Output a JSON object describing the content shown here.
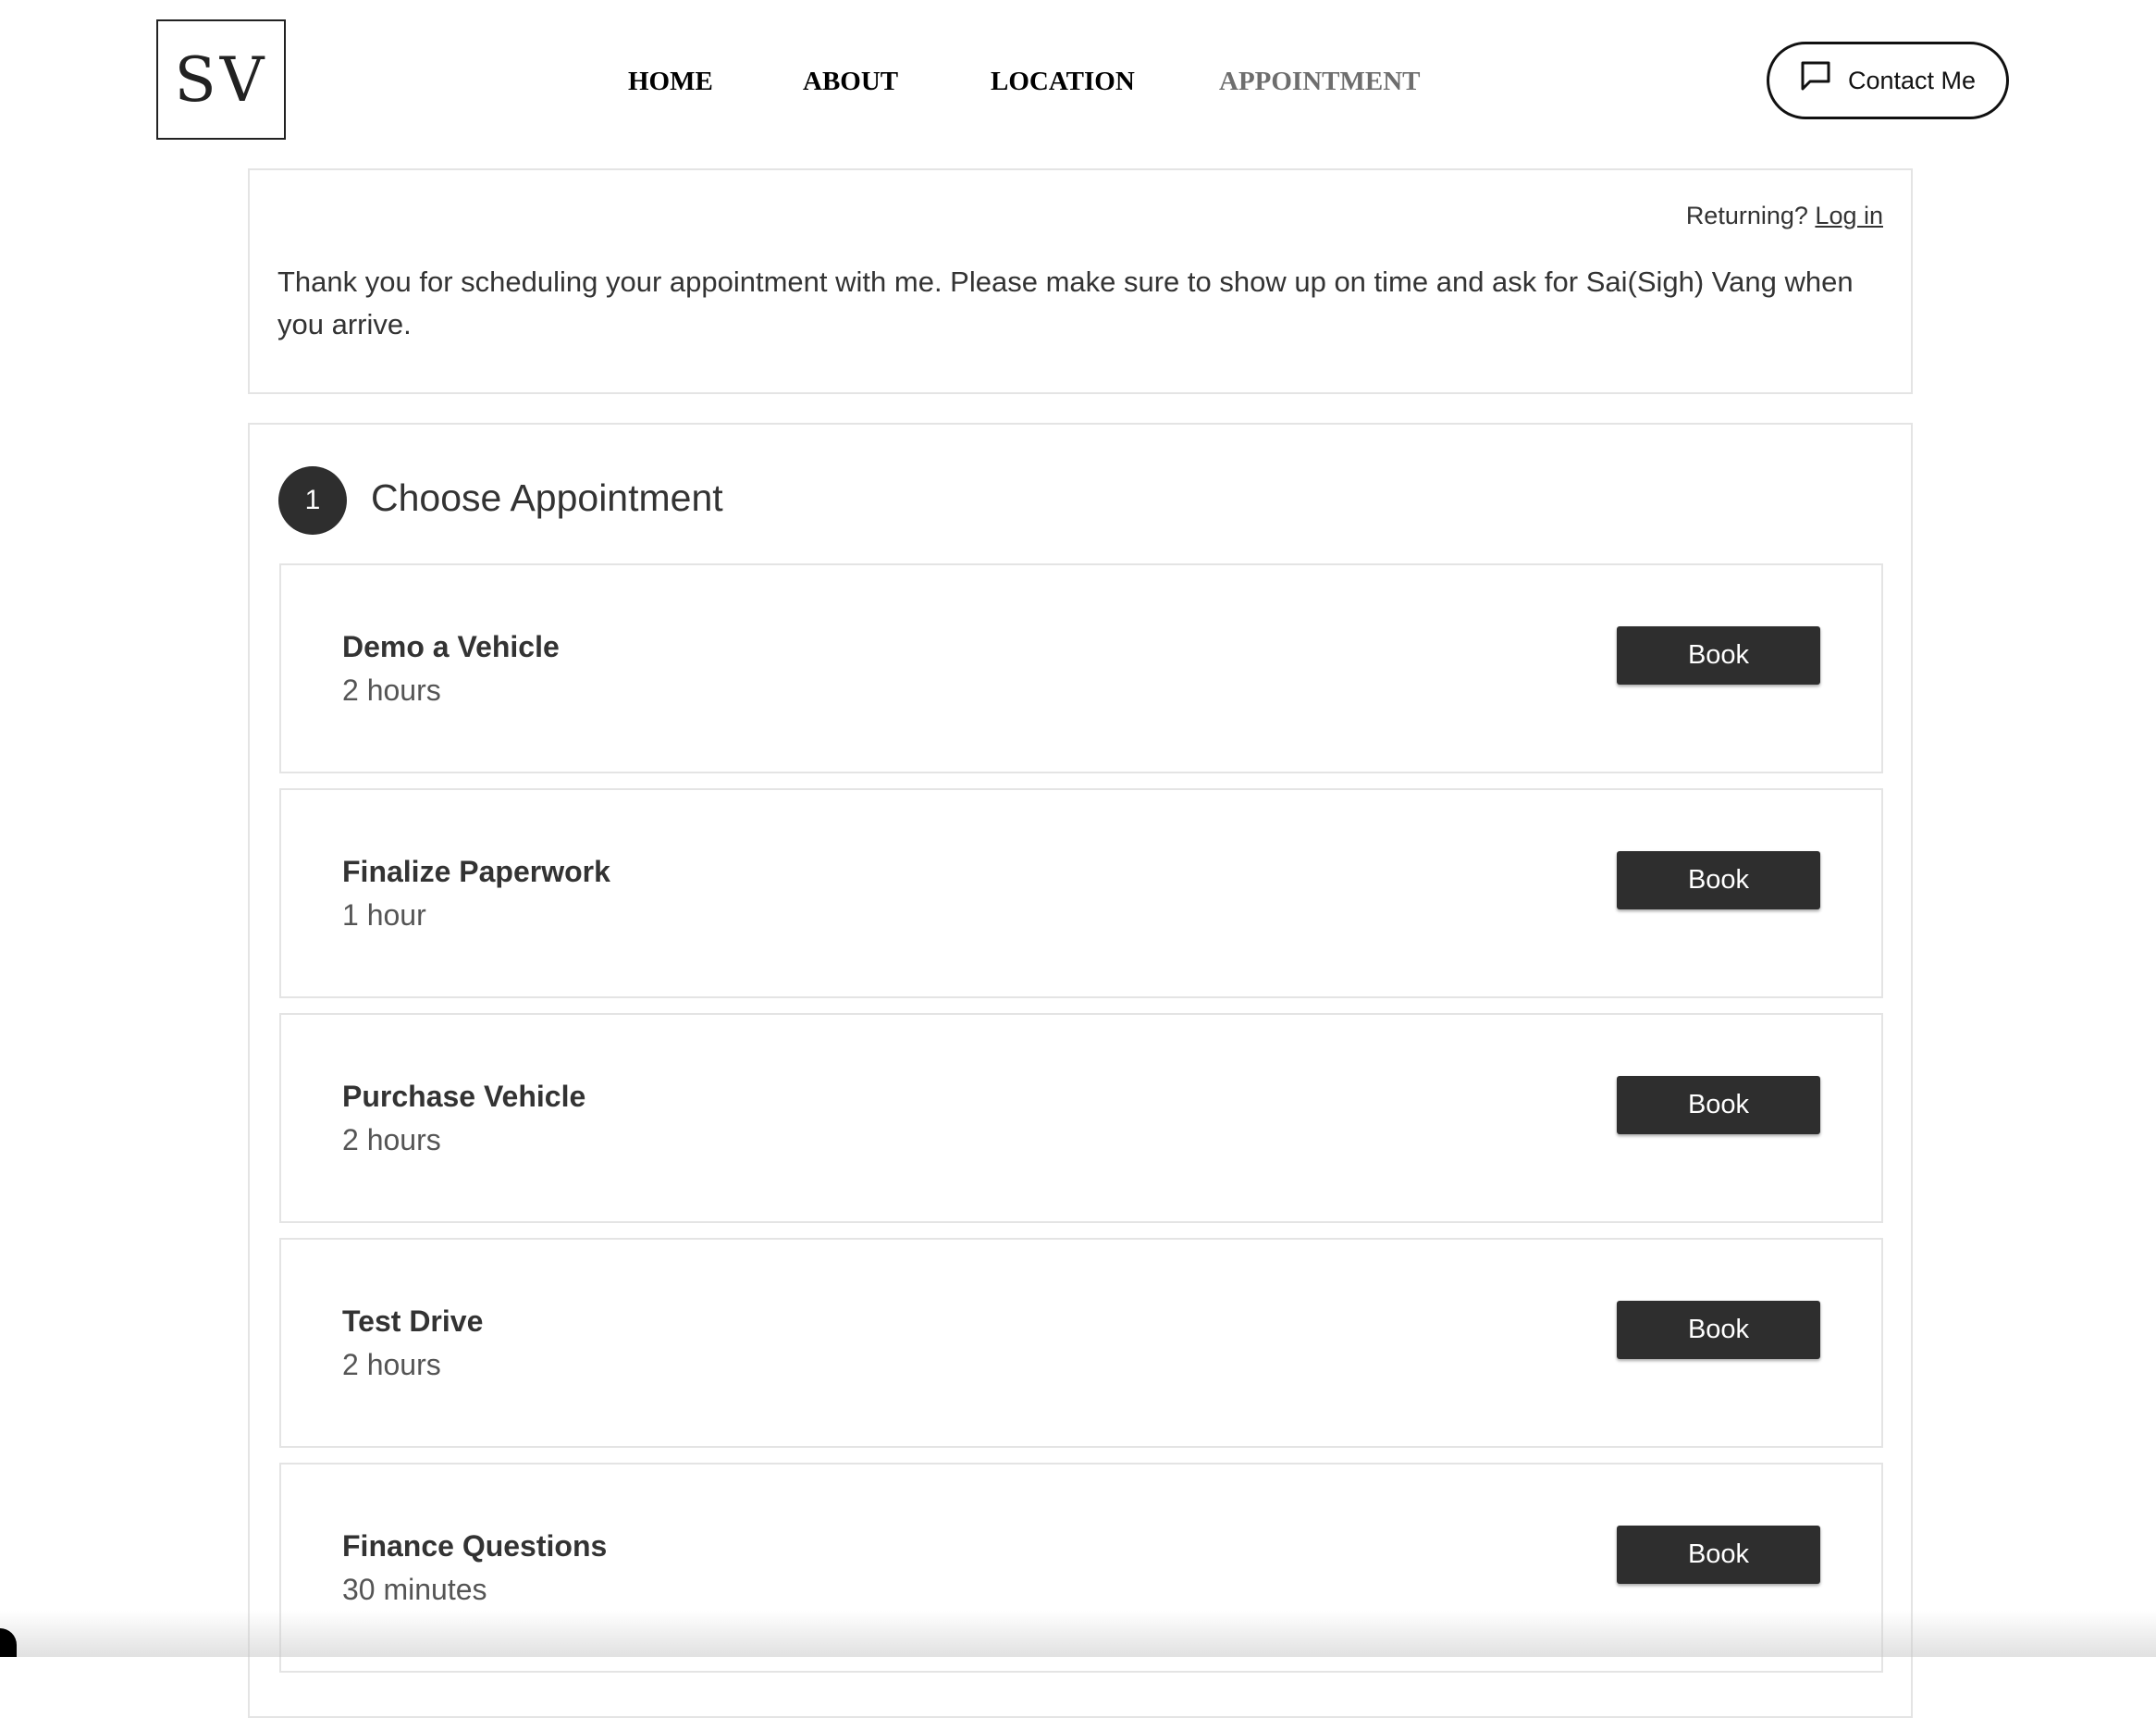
{
  "logo": {
    "text": "SV"
  },
  "nav": {
    "items": [
      {
        "label": "HOME"
      },
      {
        "label": "ABOUT"
      },
      {
        "label": "LOCATION"
      },
      {
        "label": "APPOINTMENT",
        "active": true
      }
    ]
  },
  "contact": {
    "label": "Contact Me",
    "icon": "chat-bubble-icon"
  },
  "intro": {
    "returning_text": "Returning?",
    "login_label": "Log in",
    "message": "Thank you for scheduling your appointment with me. Please make sure to show up on time and ask for Sai(Sigh) Vang when you arrive."
  },
  "step": {
    "number": "1",
    "title": "Choose Appointment"
  },
  "services": [
    {
      "name": "Demo a Vehicle",
      "duration": "2 hours",
      "button": "Book"
    },
    {
      "name": "Finalize Paperwork",
      "duration": "1 hour",
      "button": "Book"
    },
    {
      "name": "Purchase Vehicle",
      "duration": "2 hours",
      "button": "Book"
    },
    {
      "name": "Test Drive",
      "duration": "2 hours",
      "button": "Book"
    },
    {
      "name": "Finance Questions",
      "duration": "30 minutes",
      "button": "Book"
    }
  ],
  "colors": {
    "button_bg": "#2e2e2e",
    "border": "#e4e4e4",
    "text": "#333333",
    "nav_active": "#6e6e6e"
  }
}
